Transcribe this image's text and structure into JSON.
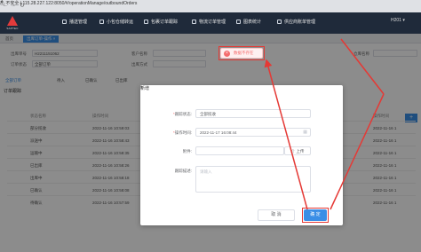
{
  "browser": {
    "warning": "不安全",
    "url": "115.28.227.122:8050/#/operationManage/outboundOrders"
  },
  "app": {
    "logo_text": "SAPTEC",
    "menu": [
      "播送管理",
      "小包仓储转运",
      "包裹订单跟踪",
      "物流订单管理",
      "图表统计",
      "供应商账单管理"
    ],
    "user": "H201"
  },
  "tabs": [
    {
      "label": "首页"
    },
    {
      "label": "出库订单-操作"
    }
  ],
  "search_form": {
    "fields": [
      {
        "label": "出库单号",
        "value": "H2211151062"
      },
      {
        "label": "订单状态",
        "value": "全部订单"
      },
      {
        "label": "客户名称",
        "value": ""
      },
      {
        "label": "出库方式",
        "value": ""
      },
      {
        "label": "仓库名称",
        "value": ""
      }
    ],
    "filter_tabs": [
      "全部订单",
      "待入",
      "已确认",
      "已出库"
    ]
  },
  "track_dialog": {
    "title": "订单跟踪",
    "columns": [
      "状态名称",
      "操作时间",
      "操作时间"
    ],
    "rows": [
      {
        "status": "部分揽收",
        "time": "2022-11-16 10:59:03",
        "time2": "2022-11-16 1"
      },
      {
        "status": "派送中",
        "time": "2022-11-16 10:58:43",
        "time2": "2022-11-16 1"
      },
      {
        "status": "运输中",
        "time": "2022-11-16 10:58:35",
        "time2": "2022-11-16 1"
      },
      {
        "status": "已出库",
        "time": "2022-11-16 10:58:26",
        "time2": "2022-11-16 1"
      },
      {
        "status": "出库中",
        "time": "2022-11-16 10:58:18",
        "time2": "2022-11-16 1"
      },
      {
        "status": "已确认",
        "time": "2022-11-16 10:58:08",
        "time2": "2022-11-16 1"
      },
      {
        "status": "待确认",
        "time": "2022-11-16 10:57:59",
        "time2": "2022-11-16 1"
      }
    ]
  },
  "add_dialog": {
    "title": "新增",
    "status_label": "跟踪状态:",
    "status_value": "全部揽收",
    "time_label": "操作时间:",
    "time_value": "2022-11-17 16:08:44",
    "attachment_label": "附件:",
    "upload_label": "上传",
    "desc_label": "跟踪描述:",
    "desc_placeholder": "请输入",
    "cancel_label": "取 消",
    "ok_label": "确 定"
  },
  "toast": {
    "message": "数据不存在"
  },
  "colors": {
    "primary": "#3a8ee6",
    "danger": "#f56c6c",
    "annotation": "#e53935",
    "header": "#1f2a3a"
  }
}
